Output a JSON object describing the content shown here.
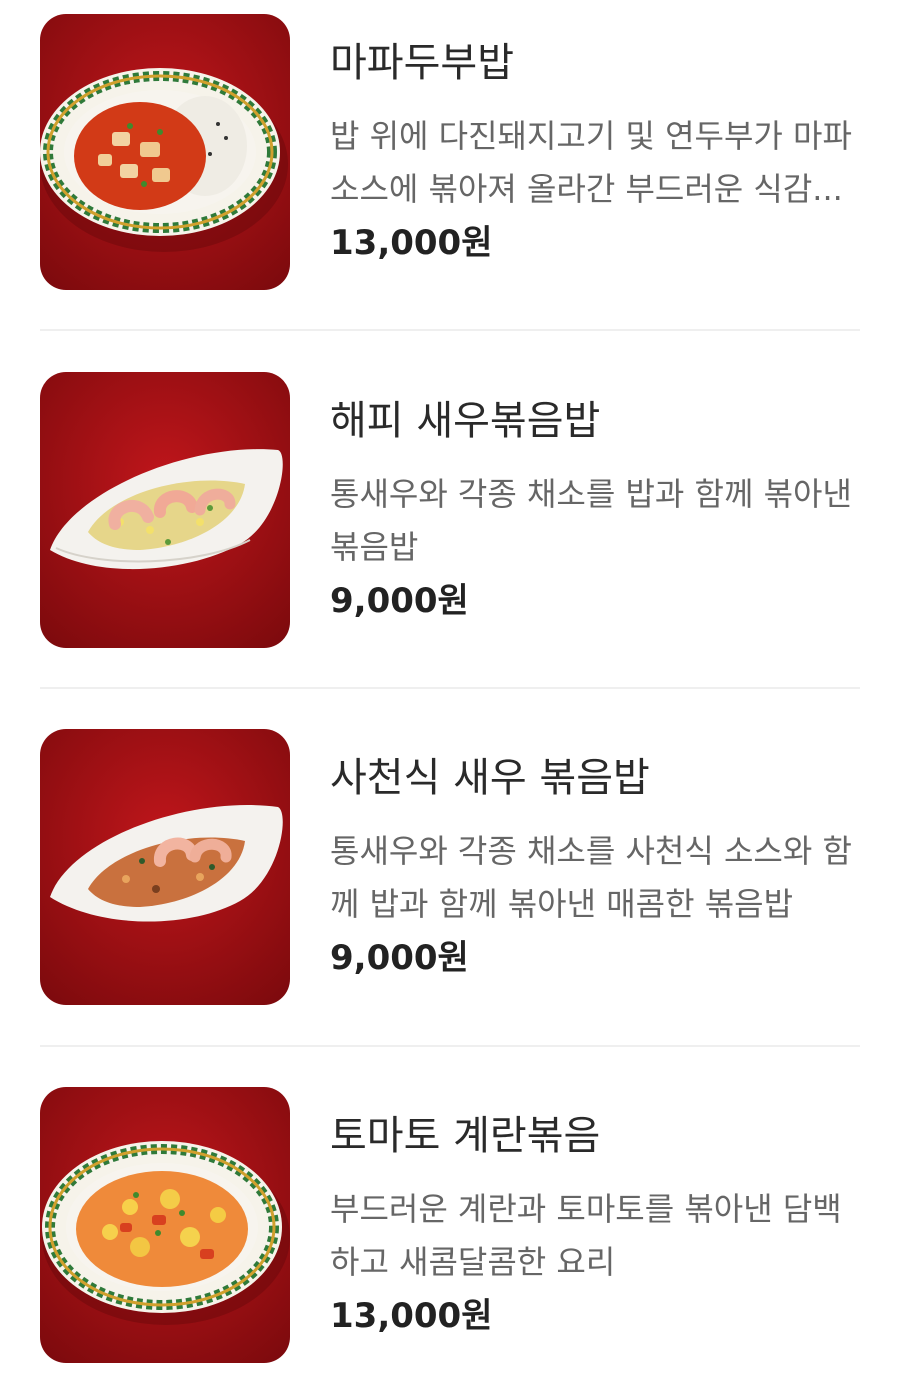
{
  "menu": {
    "items": [
      {
        "name": "마파두부밥",
        "description_lines": [
          "밥 위에 다진돼지고기 및 연두부가 마파",
          "소스에 볶아져 올라간 부드러운 식감..."
        ],
        "price": "13,000원",
        "image_icon": "mapo-tofu-rice-photo"
      },
      {
        "name": "해피 새우볶음밥",
        "description_lines": [
          "통새우와 각종 채소를 밥과 함께 볶아낸",
          "볶음밥"
        ],
        "price": "9,000원",
        "image_icon": "shrimp-fried-rice-photo"
      },
      {
        "name": "사천식 새우 볶음밥",
        "description_lines": [
          "통새우와 각종 채소를 사천식 소스와 함",
          "께 밥과 함께 볶아낸 매콤한 볶음밥"
        ],
        "price": "9,000원",
        "image_icon": "sichuan-shrimp-fried-rice-photo"
      },
      {
        "name": "토마토 계란볶음",
        "description_lines": [
          "부드러운 계란과 토마토를 볶아낸 담백",
          "하고 새콤달콤한 요리"
        ],
        "price": "13,000원",
        "image_icon": "tomato-egg-stirfry-photo"
      }
    ]
  }
}
